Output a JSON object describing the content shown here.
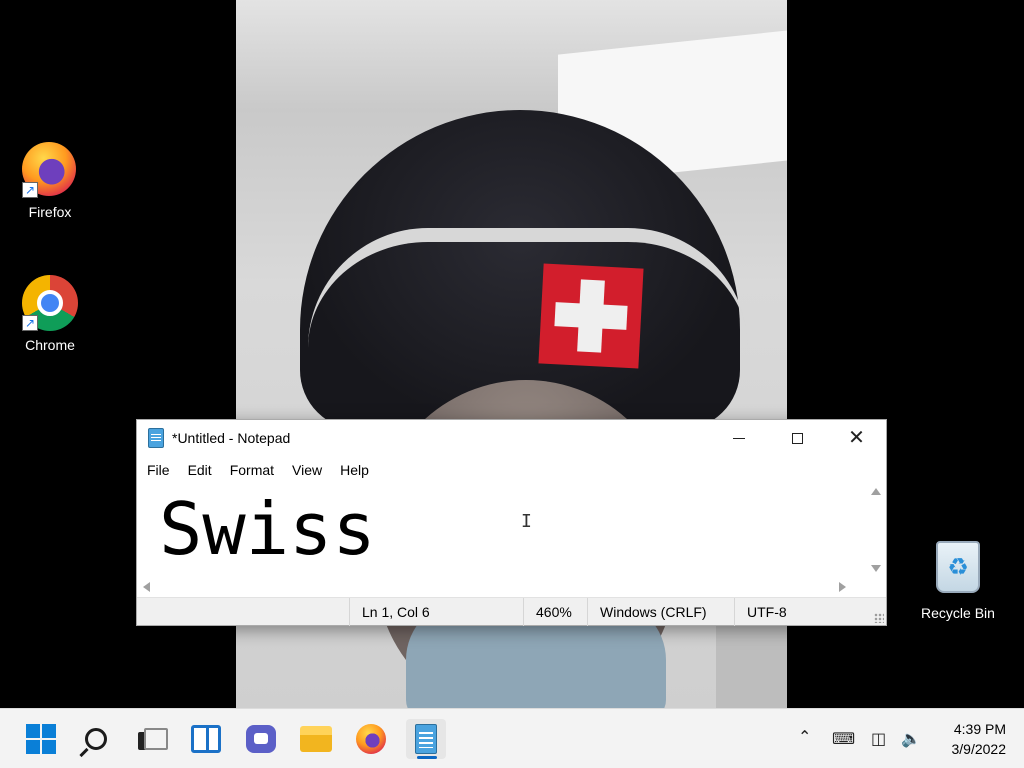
{
  "desktop": {
    "icons": [
      {
        "label": "Firefox",
        "icon": "firefox-icon"
      },
      {
        "label": "Chrome",
        "icon": "chrome-icon"
      },
      {
        "label": "Recycle Bin",
        "icon": "recycle-bin-icon"
      }
    ]
  },
  "notepad": {
    "title": "*Untitled - Notepad",
    "menu": [
      "File",
      "Edit",
      "Format",
      "View",
      "Help"
    ],
    "content": "Swiss",
    "status": {
      "position": "Ln 1, Col 6",
      "zoom": "460%",
      "line_endings": "Windows (CRLF)",
      "encoding": "UTF-8"
    }
  },
  "taskbar": {
    "apps": [
      "start-icon",
      "search-icon",
      "task-view-icon",
      "widgets-icon",
      "chat-icon",
      "file-explorer-icon",
      "firefox-icon",
      "notepad-icon"
    ],
    "active_app": "notepad-icon",
    "clock": {
      "time": "4:39 PM",
      "date": "3/9/2022"
    }
  },
  "colors": {
    "accent": "#0a66c2",
    "taskbar_bg": "#f3f3f3",
    "statusbar_bg": "#f0f0f0"
  }
}
